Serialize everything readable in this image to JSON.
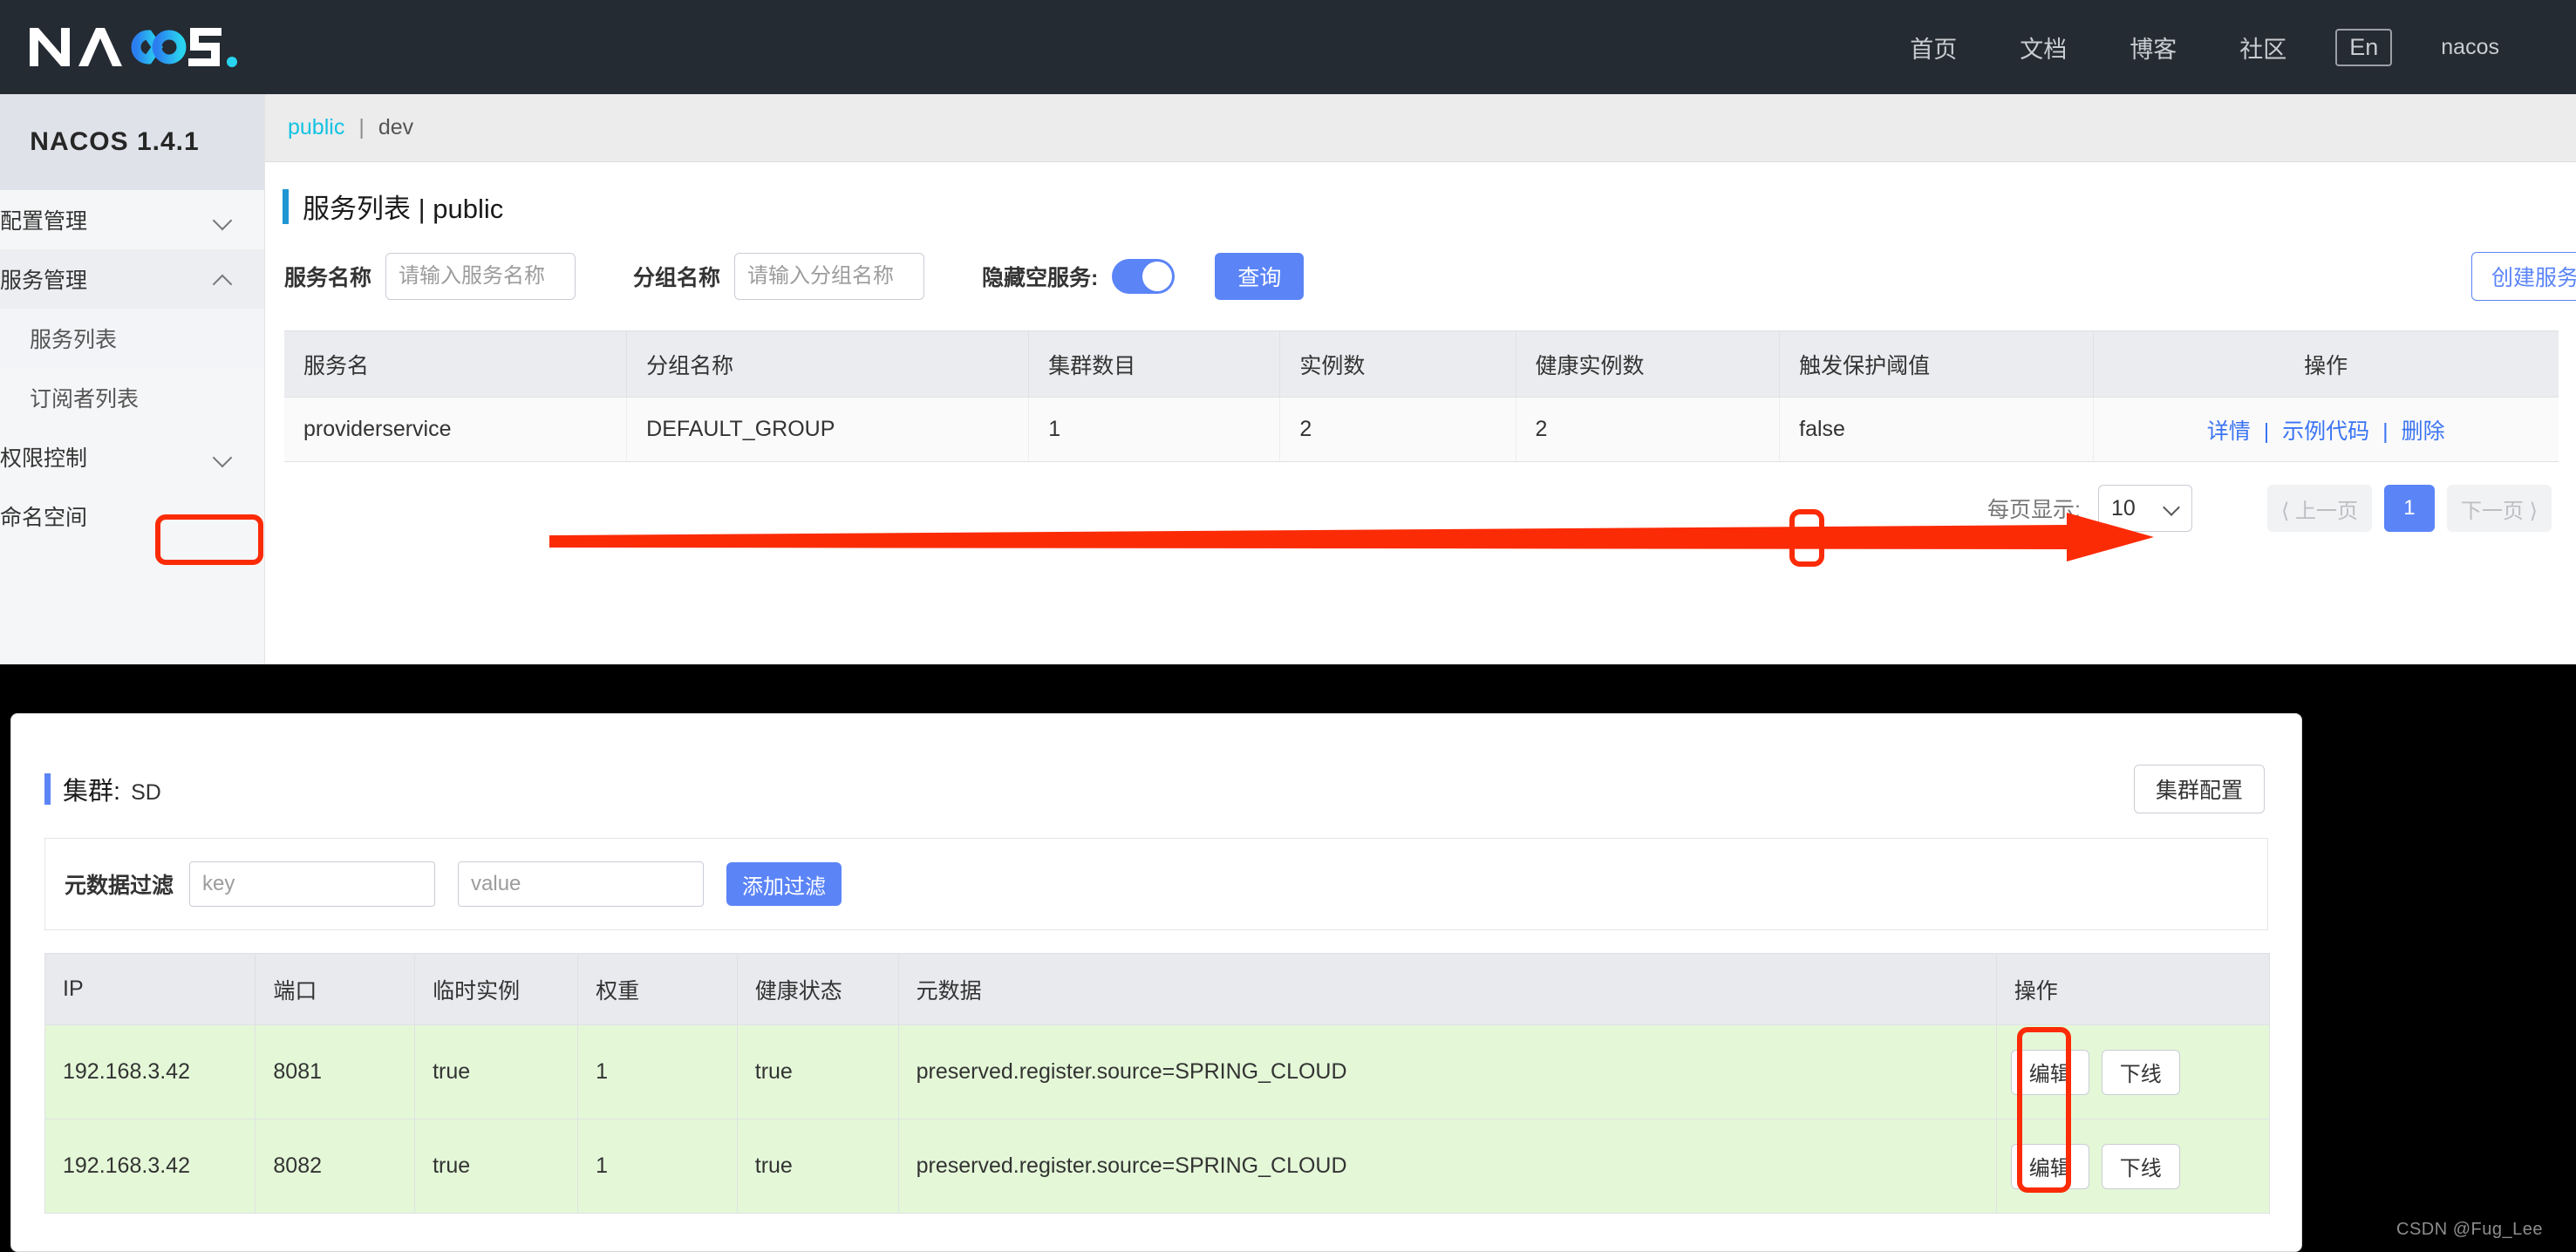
{
  "header": {
    "logo_text": "NACOS.",
    "nav_items": [
      {
        "label": "首页",
        "name": "nav-home"
      },
      {
        "label": "文档",
        "name": "nav-docs"
      },
      {
        "label": "博客",
        "name": "nav-blog"
      },
      {
        "label": "社区",
        "name": "nav-community"
      }
    ],
    "lang_toggle": "En",
    "user": "nacos"
  },
  "sidebar": {
    "product_title": "NACOS 1.4.1",
    "items": [
      {
        "label": "配置管理",
        "icon": "chevron-down-icon",
        "expanded": false
      },
      {
        "label": "服务管理",
        "icon": "chevron-up-icon",
        "expanded": true
      },
      {
        "label": "权限控制",
        "icon": "chevron-down-icon",
        "expanded": false
      },
      {
        "label": "命名空间",
        "icon": "",
        "expanded": false
      }
    ],
    "sub_items": [
      {
        "label": "服务列表",
        "active": true
      },
      {
        "label": "订阅者列表",
        "active": false
      }
    ]
  },
  "breadcrumb": {
    "namespace_link": "public",
    "separator": "|",
    "current": "dev"
  },
  "page": {
    "title": "服务列表 | public"
  },
  "filters": {
    "service_name_label": "服务名称",
    "service_name_placeholder": "请输入服务名称",
    "service_name_value": "",
    "group_name_label": "分组名称",
    "group_name_placeholder": "请输入分组名称",
    "group_name_value": "",
    "hide_empty_label": "隐藏空服务:",
    "hide_empty_on": true,
    "query_button": "查询",
    "create_button": "创建服务"
  },
  "services_table": {
    "columns": [
      "服务名",
      "分组名称",
      "集群数目",
      "实例数",
      "健康实例数",
      "触发保护阈值",
      "操作"
    ],
    "rows": [
      {
        "service_name": "providerservice",
        "group_name": "DEFAULT_GROUP",
        "cluster_count": "1",
        "instance_count": "2",
        "healthy_instance_count": "2",
        "protect_threshold": "false",
        "ops": [
          "详情",
          "示例代码",
          "删除"
        ]
      }
    ]
  },
  "pagination": {
    "page_size_label": "每页显示:",
    "page_size_value": "10",
    "prev_label": "上一页",
    "next_label": "下一页",
    "current_page": "1"
  },
  "detail": {
    "cluster_label": "集群:",
    "cluster_value": "SD",
    "cluster_config_button": "集群配置",
    "metadata_filter_label": "元数据过滤",
    "key_placeholder": "key",
    "key_value": "",
    "value_placeholder": "value",
    "value_value": "",
    "add_filter_button": "添加过滤",
    "instances_columns": [
      "IP",
      "端口",
      "临时实例",
      "权重",
      "健康状态",
      "元数据",
      "操作"
    ],
    "instances": [
      {
        "ip": "192.168.3.42",
        "port": "8081",
        "ephemeral": "true",
        "weight": "1",
        "healthy": "true",
        "metadata": "preserved.register.source=SPRING_CLOUD",
        "edit_button": "编辑",
        "offline_button": "下线"
      },
      {
        "ip": "192.168.3.42",
        "port": "8082",
        "ephemeral": "true",
        "weight": "1",
        "healthy": "true",
        "metadata": "preserved.register.source=SPRING_CLOUD",
        "edit_button": "编辑",
        "offline_button": "下线"
      }
    ]
  },
  "annotations": {
    "color": "#fb2b06",
    "highlight_service_name": "providerservice",
    "highlight_detail_link": "详情",
    "highlight_edit_buttons": "编辑"
  },
  "watermark": "CSDN @Fug_Lee",
  "colors": {
    "header_bg": "#252b33",
    "accent_blue": "#5b84f7",
    "link_blue": "#3b74f2",
    "crumb_cyan": "#13c2e3",
    "row_green": "#e4f8d8",
    "annotation_red": "#fb2b06"
  }
}
